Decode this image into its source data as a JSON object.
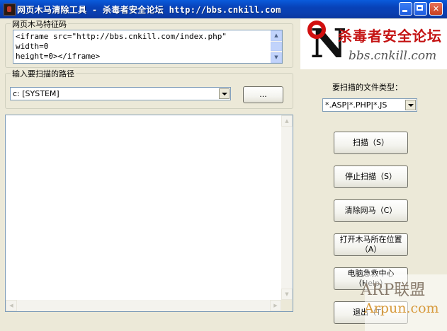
{
  "window": {
    "title": "网页木马清除工具 - 杀毒者安全论坛 http://bbs.cnkill.com"
  },
  "signature": {
    "group_label": "网页木马特征码",
    "lines": [
      "<iframe src=\"http://bbs.cnkill.com/index.php\"",
      "width=0",
      "height=0></iframe>"
    ]
  },
  "path": {
    "group_label": "输入要扫描的路径",
    "selected": "c: [SYSTEM]",
    "browse_label": "..."
  },
  "logo": {
    "brand_cn": "杀毒者安全论坛",
    "url": "bbs.cnkill.com"
  },
  "filetype": {
    "label": "要扫描的文件类型：",
    "selected": "*.ASP|*.PHP|*.JS"
  },
  "buttons": {
    "scan": "扫描（S）",
    "stop": "停止扫描（S）",
    "clear": "清除网马（C）",
    "open_location": "打开木马所在位置（A）",
    "rescue_help": "电脑急救中心 （Help）",
    "exit": "退出（T）"
  },
  "watermark": {
    "line1": "ARP联盟",
    "line2": "Arpun.com"
  }
}
